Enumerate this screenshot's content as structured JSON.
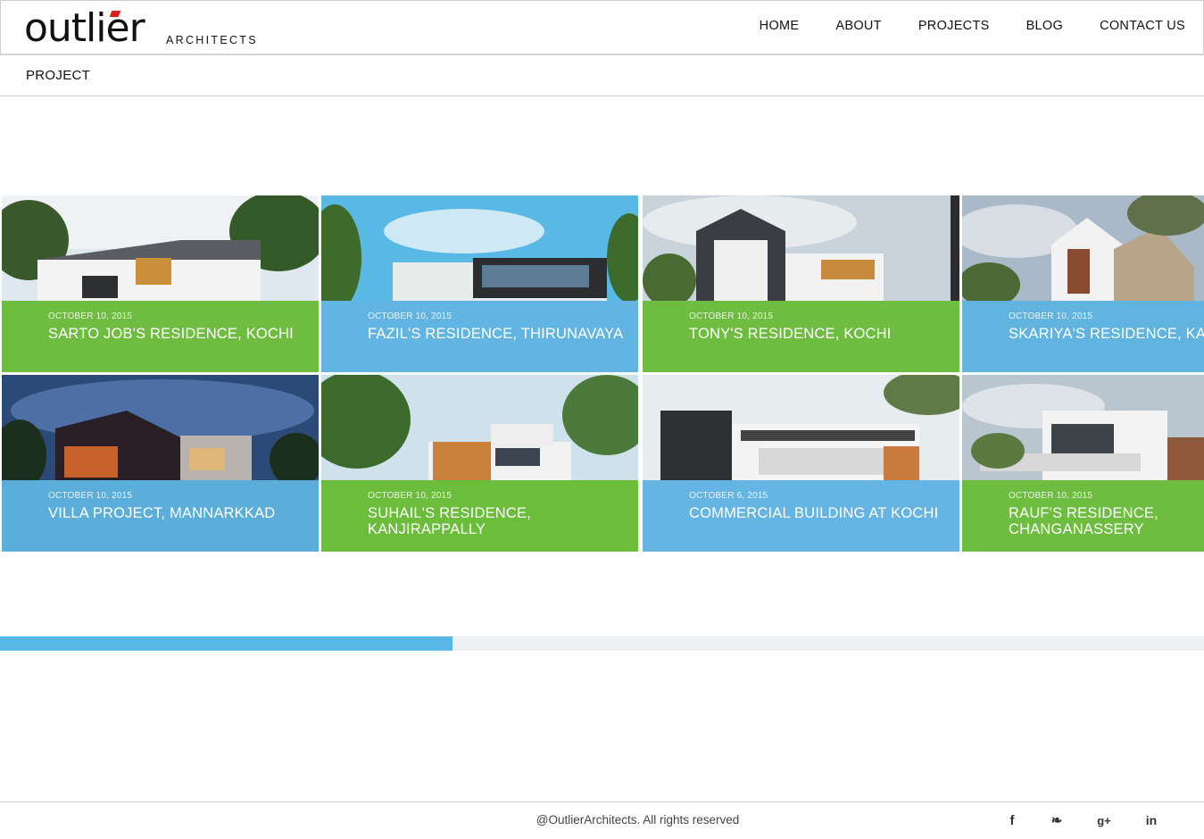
{
  "header": {
    "logo_text": "outlier",
    "logo_sub": "ARCHITECTS",
    "nav": [
      "HOME",
      "ABOUT",
      "PROJECTS",
      "BLOG",
      "CONTACT US"
    ]
  },
  "breadcrumb": {
    "title": "PROJECT"
  },
  "projects": [
    {
      "date": "OCTOBER 10, 2015",
      "title": "SARTO JOB'S RESIDENCE, KOCHI",
      "overlay": "green"
    },
    {
      "date": "OCTOBER 10, 2015",
      "title": "FAZIL'S RESIDENCE, THIRUNAVAYA",
      "overlay": "blue"
    },
    {
      "date": "OCTOBER 10, 2015",
      "title": "TONY'S RESIDENCE, KOCHI",
      "overlay": "green"
    },
    {
      "date": "OCTOBER 10, 2015",
      "title": "SKARIYA'S RESIDENCE, KAL",
      "overlay": "blue"
    },
    {
      "date": "OCTOBER 10, 2015",
      "title": "VILLA PROJECT, MANNARKKAD",
      "overlay": "blue"
    },
    {
      "date": "OCTOBER 10, 2015",
      "title": "SUHAIL'S RESIDENCE, KANJIRAPPALLY",
      "overlay": "green"
    },
    {
      "date": "OCTOBER 6, 2015",
      "title": "COMMERCIAL BUILDING AT KOCHI",
      "overlay": "blue"
    },
    {
      "date": "OCTOBER 10, 2015",
      "title": "RAUF'S RESIDENCE, CHANGANASSERY",
      "overlay": "green"
    }
  ],
  "progress": {
    "fraction": 0.376
  },
  "footer": {
    "copyright": "@OutlierArchitects. All rights reserved",
    "social": [
      {
        "icon": "facebook-icon",
        "glyph": "f"
      },
      {
        "icon": "twitter-icon",
        "glyph": "❧"
      },
      {
        "icon": "google-plus-icon",
        "glyph": "g+"
      },
      {
        "icon": "linkedin-icon",
        "glyph": "in"
      }
    ]
  },
  "colors": {
    "green_overlay": "#6cc03a",
    "blue_overlay": "#5cb6e8",
    "progress": "#58b7e6"
  }
}
